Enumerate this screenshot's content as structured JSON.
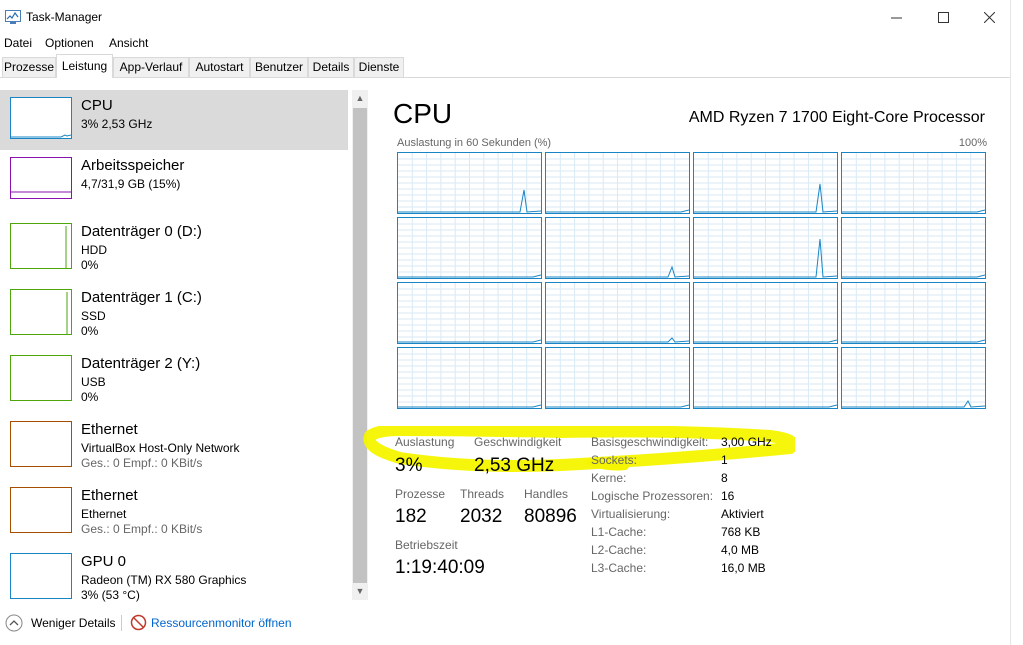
{
  "window": {
    "title": "Task-Manager",
    "app_icon": "task-manager-icon"
  },
  "menu": [
    "Datei",
    "Optionen",
    "Ansicht"
  ],
  "tabs": [
    "Prozesse",
    "Leistung",
    "App-Verlauf",
    "Autostart",
    "Benutzer",
    "Details",
    "Dienste"
  ],
  "active_tab": "Leistung",
  "sidebar": [
    {
      "title": "CPU",
      "lines": [
        "3% 2,53 GHz"
      ],
      "color": "#1a85c4",
      "selected": true
    },
    {
      "title": "Arbeitsspeicher",
      "lines": [
        "4,7/31,9 GB (15%)"
      ],
      "color": "#8b12ae"
    },
    {
      "title": "Datenträger 0 (D:)",
      "lines": [
        "HDD",
        "0%"
      ],
      "color": "#4da60c"
    },
    {
      "title": "Datenträger 1 (C:)",
      "lines": [
        "SSD",
        "0%"
      ],
      "color": "#4da60c"
    },
    {
      "title": "Datenträger 2 (Y:)",
      "lines": [
        "USB",
        "0%"
      ],
      "color": "#4da60c"
    },
    {
      "title": "Ethernet",
      "lines": [
        "VirtualBox Host-Only Network",
        "Ges.: 0 Empf.: 0 KBit/s"
      ],
      "color": "#a74f01"
    },
    {
      "title": "Ethernet",
      "lines": [
        "Ethernet",
        "Ges.: 0 Empf.: 0 KBit/s"
      ],
      "color": "#a74f01"
    },
    {
      "title": "GPU 0",
      "lines": [
        "Radeon (TM) RX 580 Graphics",
        "3% (53 °C)"
      ],
      "color": "#1a85c4"
    }
  ],
  "cpu": {
    "heading": "CPU",
    "model": "AMD Ryzen 7 1700 Eight-Core Processor",
    "graph_label": "Auslastung in 60 Sekunden (%)",
    "graph_max": "100%",
    "stats": {
      "auslastung_label": "Auslastung",
      "auslastung": "3%",
      "geschwindigkeit_label": "Geschwindigkeit",
      "geschwindigkeit": "2,53 GHz",
      "prozesse_label": "Prozesse",
      "prozesse": "182",
      "threads_label": "Threads",
      "threads": "2032",
      "handles_label": "Handles",
      "handles": "80896",
      "betriebszeit_label": "Betriebszeit",
      "betriebszeit": "1:19:40:09"
    },
    "info": [
      [
        "Basisgeschwindigkeit:",
        "3,00 GHz"
      ],
      [
        "Sockets:",
        "1"
      ],
      [
        "Kerne:",
        "8"
      ],
      [
        "Logische Prozessoren:",
        "16"
      ],
      [
        "Virtualisierung:",
        "Aktiviert"
      ],
      [
        "L1-Cache:",
        "768 KB"
      ],
      [
        "L2-Cache:",
        "4,0 MB"
      ],
      [
        "L3-Cache:",
        "16,0 MB"
      ]
    ]
  },
  "footer": {
    "fewer_details": "Weniger Details",
    "resource_monitor": "Ressourcenmonitor öffnen"
  },
  "colors": {
    "cpu_line": "#1a85c4",
    "highlight": "#f5f500"
  }
}
